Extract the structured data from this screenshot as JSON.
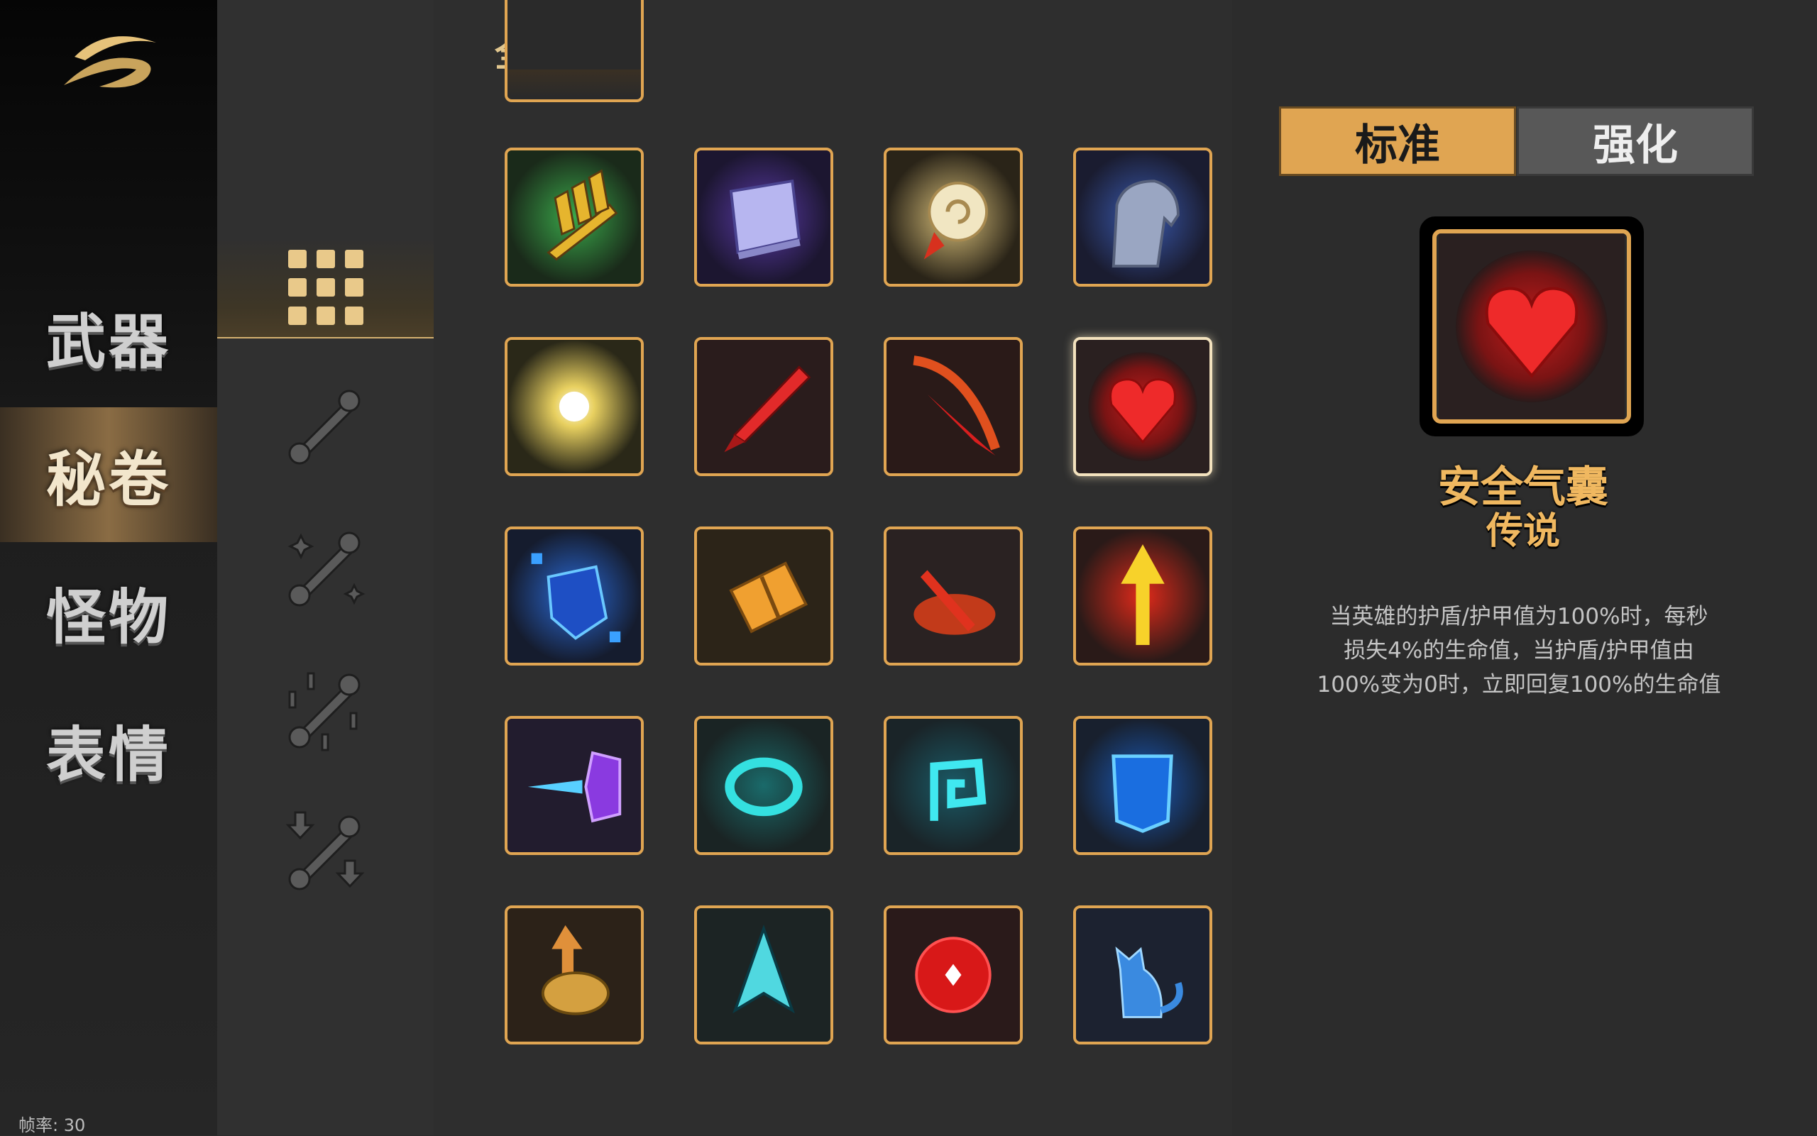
{
  "categories": [
    {
      "id": "weapons",
      "label": "武器"
    },
    {
      "id": "scrolls",
      "label": "秘卷",
      "active": true
    },
    {
      "id": "monsters",
      "label": "怪物"
    },
    {
      "id": "emotes",
      "label": "表情"
    }
  ],
  "filters": [
    {
      "icon": "grid-all-icon",
      "active": true
    },
    {
      "icon": "scroll-icon"
    },
    {
      "icon": "sparkle-scroll-icon"
    },
    {
      "icon": "burst-scroll-icon"
    },
    {
      "icon": "arrow-scroll-icon"
    }
  ],
  "grid": {
    "title": "全部",
    "rows": [
      [
        "bullets-icon",
        "spellbook-icon",
        "spiral-scroll-icon",
        "stone-fist-icon"
      ],
      [
        "light-burst-icon",
        "red-dagger-icon",
        "red-slash-icon",
        "heart-icon"
      ],
      [
        "blue-crystal-icon",
        "golden-bundle-icon",
        "fire-strike-icon",
        "up-arrow-icon"
      ],
      [
        "purple-gem-dash-icon",
        "cyan-ring-icon",
        "cyan-spiral-icon",
        "blue-shield-icon"
      ],
      [
        "gold-coin-arrow-icon",
        "cyan-arrowhead-icon",
        "red-orb-icon",
        "blue-cat-icon"
      ]
    ],
    "selected": "heart-icon"
  },
  "detail": {
    "tabs": {
      "standard": "标准",
      "enhanced": "强化"
    },
    "item_icon": "heart-icon",
    "name": "安全气囊",
    "rarity": "传说",
    "description": [
      "当英雄的护盾/护甲值为100%时，每秒",
      "损失4%的生命值，当护盾/护甲值由",
      "100%变为0时，立即回复100%的生命值"
    ]
  },
  "fps_label": "帧率: 30",
  "colors": {
    "accent": "#e0a552",
    "gold_text": "#f0b860",
    "panel": "#2e2e2e"
  }
}
